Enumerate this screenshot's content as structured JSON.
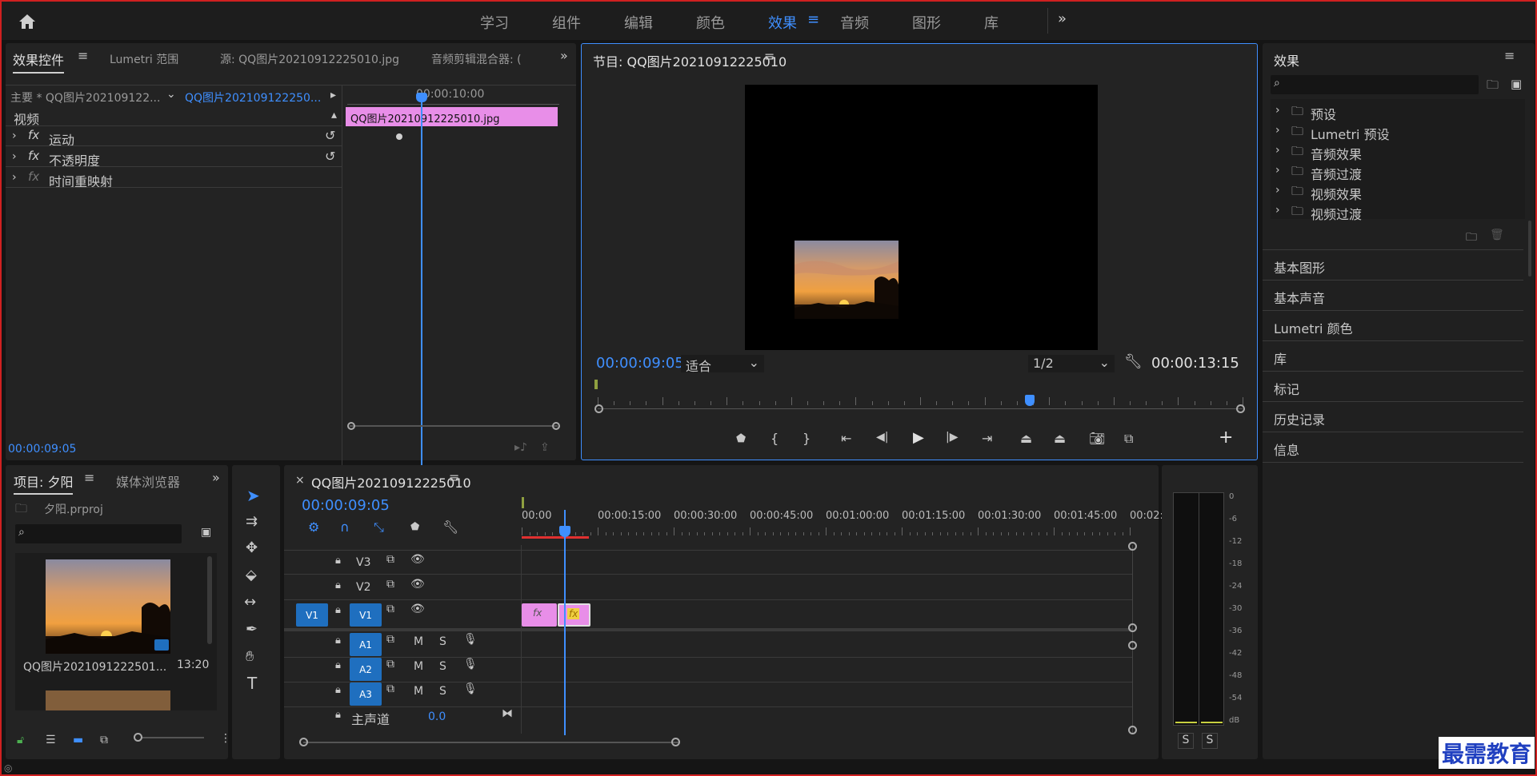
{
  "topbar": {
    "workspaces": [
      "学习",
      "组件",
      "编辑",
      "颜色",
      "效果",
      "音频",
      "图形",
      "库"
    ],
    "active": "效果"
  },
  "effect_controls": {
    "tabs": [
      "效果控件",
      "Lumetri 范围",
      "源: QQ图片20210912225010.jpg",
      "音频剪辑混合器: ("
    ],
    "master": "主要 * QQ图片202109122...",
    "clip": "QQ图片202109122250...",
    "time_label": "00:00:10:00",
    "clip_bar": "QQ图片20210912225010.jpg",
    "section": "视频",
    "effects": [
      "运动",
      "不透明度",
      "时间重映射"
    ],
    "timecode": "00:00:09:05"
  },
  "program": {
    "title": "节目: QQ图片20210912225010",
    "timecode": "00:00:09:05",
    "fit": "适合",
    "resolution": "1/2",
    "duration": "00:00:13:15",
    "playhead_fraction": 0.67
  },
  "effects_panel": {
    "title": "效果",
    "tree": [
      "预设",
      "Lumetri 预设",
      "音频效果",
      "音频过渡",
      "视频效果",
      "视频过渡"
    ],
    "sections": [
      "基本图形",
      "基本声音",
      "Lumetri 颜色",
      "库",
      "标记",
      "历史记录",
      "信息"
    ]
  },
  "project": {
    "tabs": [
      "项目: 夕阳",
      "媒体浏览器"
    ],
    "file": "夕阳.prproj",
    "item_name": "QQ图片2021091222501...",
    "item_duration": "13:20"
  },
  "timeline": {
    "title": "QQ图片20210912225010",
    "timecode": "00:00:09:05",
    "ruler": [
      "00:00",
      "00:00:15:00",
      "00:00:30:00",
      "00:00:45:00",
      "00:01:00:00",
      "00:01:15:00",
      "00:01:30:00",
      "00:01:45:00",
      "00:02:0"
    ],
    "video_tracks": [
      "V3",
      "V2",
      "V1"
    ],
    "audio_tracks": [
      "A1",
      "A2",
      "A3"
    ],
    "source_patch": "V1",
    "master_label": "主声道",
    "master_value": "0.0",
    "m_label": "M",
    "s_label": "S"
  },
  "meter": {
    "scale": [
      "0",
      "-6",
      "-12",
      "-18",
      "-24",
      "-30",
      "-36",
      "-42",
      "-48",
      "-54",
      "dB"
    ],
    "solo": [
      "S",
      "S"
    ]
  },
  "watermark": "最需教育",
  "colors": {
    "accent": "#3f8fff",
    "clip": "#e88ee8",
    "brand_red": "#d02020"
  }
}
